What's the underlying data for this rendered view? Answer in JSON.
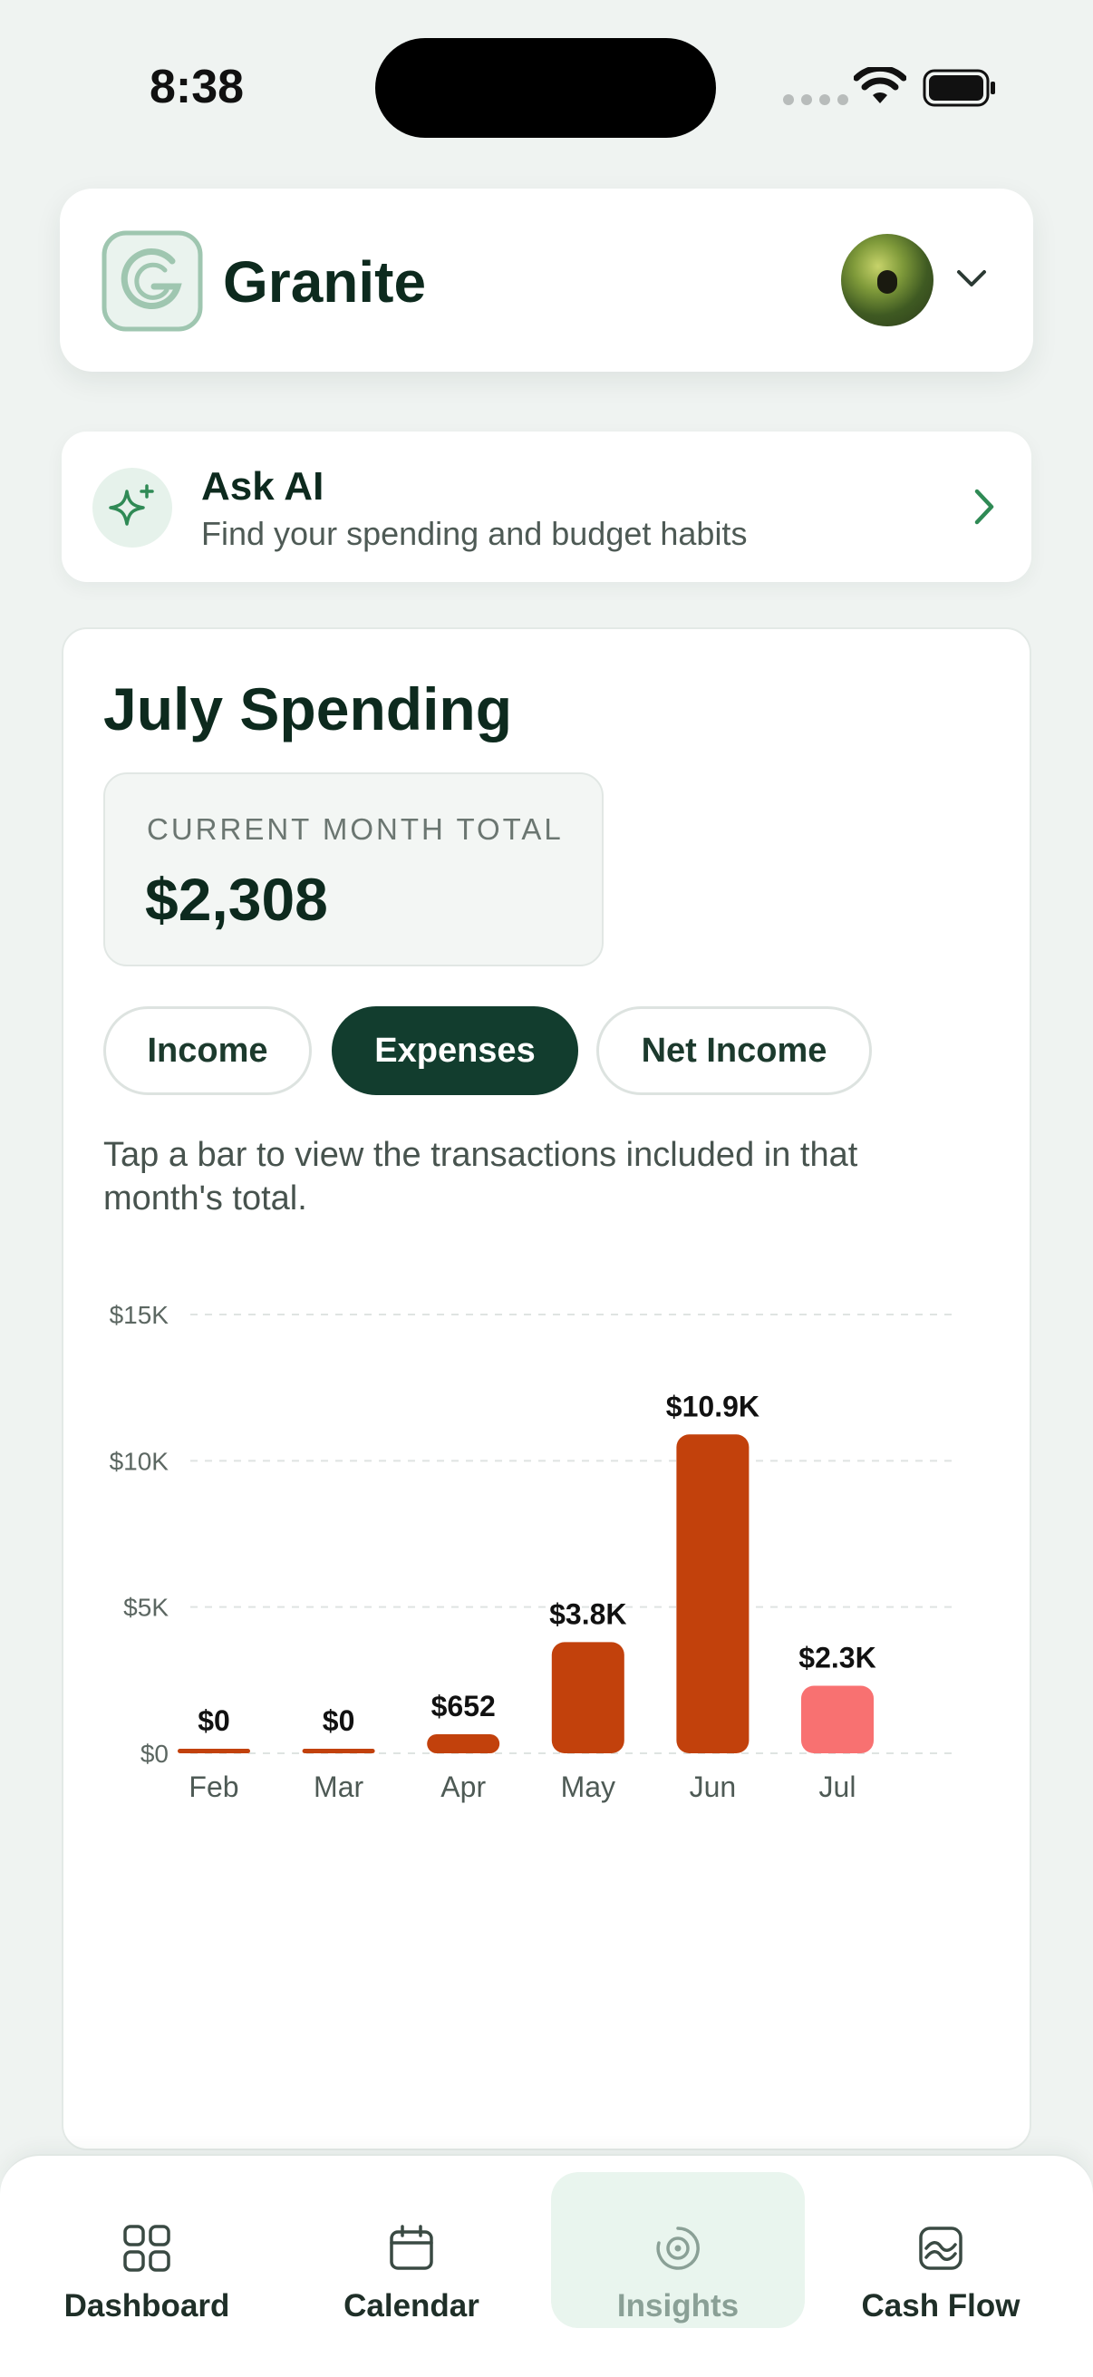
{
  "status": {
    "time": "8:38"
  },
  "header": {
    "title": "Granite"
  },
  "ask_ai": {
    "title": "Ask AI",
    "subtitle": "Find your spending and budget habits"
  },
  "spending": {
    "title": "July Spending",
    "total_label": "CURRENT MONTH TOTAL",
    "total_value": "$2,308",
    "segments": [
      {
        "label": "Income",
        "active": false
      },
      {
        "label": "Expenses",
        "active": true
      },
      {
        "label": "Net Income",
        "active": false
      }
    ],
    "hint": "Tap a bar to view the transactions included in that month's total."
  },
  "chart_data": {
    "type": "bar",
    "categories": [
      "Feb",
      "Mar",
      "Apr",
      "May",
      "Jun",
      "Jul"
    ],
    "values": [
      0,
      0,
      652,
      3800,
      10900,
      2308
    ],
    "data_labels": [
      "$0",
      "$0",
      "$652",
      "$3.8K",
      "$10.9K",
      "$2.3K"
    ],
    "yticks": [
      0,
      5000,
      10000,
      15000
    ],
    "ytick_labels": [
      "$0",
      "$5K",
      "$10K",
      "$15K"
    ],
    "ylim": [
      0,
      15000
    ],
    "grid": true,
    "bar_color": "#c2410c",
    "highlight_color": "#f87171",
    "highlight_index": 5
  },
  "tabs": [
    {
      "label": "Dashboard",
      "icon": "grid-icon"
    },
    {
      "label": "Calendar",
      "icon": "calendar-icon"
    },
    {
      "label": "Insights",
      "icon": "insights-icon",
      "active": true
    },
    {
      "label": "Cash Flow",
      "icon": "cash-flow-icon"
    }
  ],
  "colors": {
    "brand_dark": "#123d2e",
    "accent_green": "#2f8a55",
    "background": "#eff3f1"
  }
}
